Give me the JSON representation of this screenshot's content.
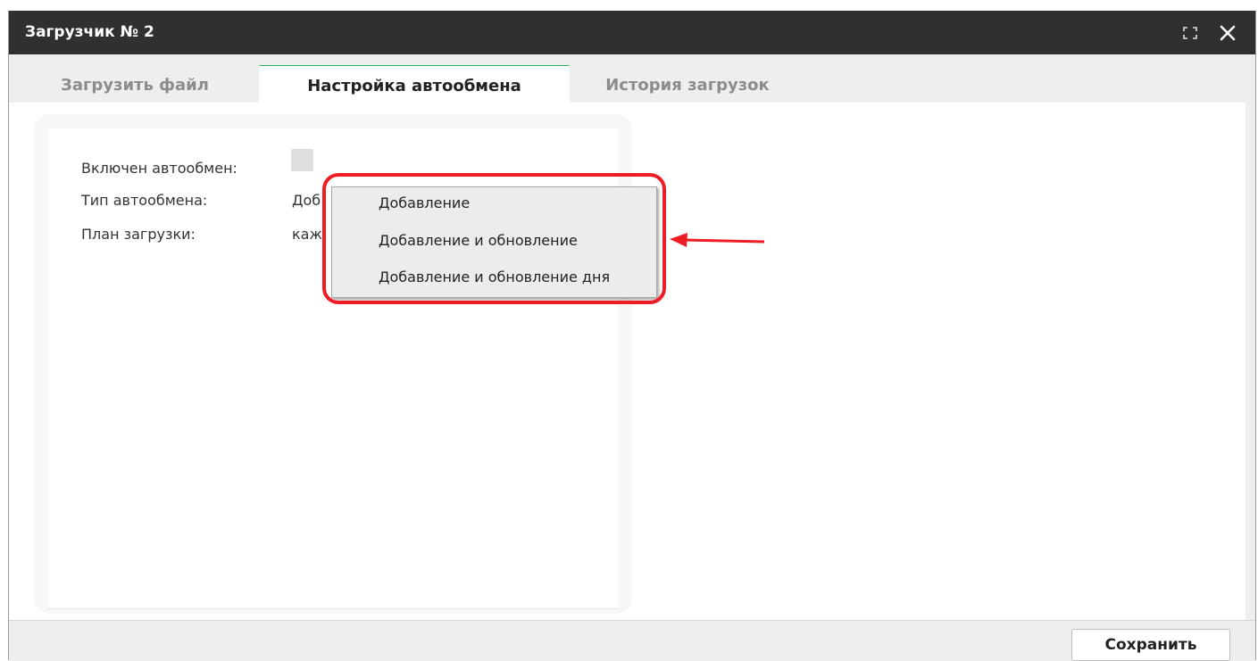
{
  "window": {
    "title": "Загрузчик № 2"
  },
  "tabs": [
    {
      "label": "Загрузить файл"
    },
    {
      "label": "Настройка автообмена"
    },
    {
      "label": "История загрузок"
    }
  ],
  "form": {
    "autoexchange_enabled_label": "Включен автообмен:",
    "autoexchange_enabled": false,
    "exchange_type_label": "Тип автообмена:",
    "exchange_type_value_visible": "Доб",
    "schedule_label": "План загрузки:",
    "schedule_value_visible": "каж"
  },
  "dropdown": {
    "options": [
      "Добавление",
      "Добавление и обновление",
      "Добавление и обновление дня"
    ]
  },
  "footer": {
    "save_label": "Сохранить"
  },
  "colors": {
    "titlebar": "#303030",
    "active_tab_accent": "#27ae60",
    "highlight": "#ee1c24"
  },
  "icons": {
    "maximize": "maximize-icon",
    "close": "close-icon"
  }
}
